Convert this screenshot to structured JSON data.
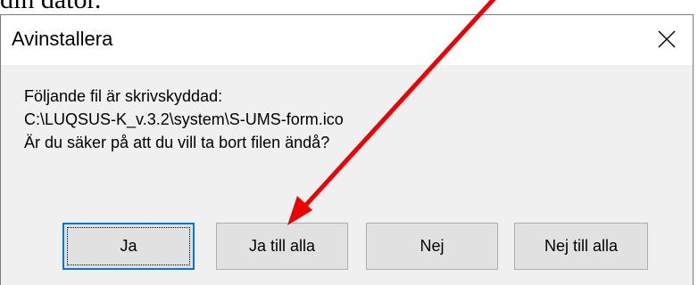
{
  "page": {
    "above_text": "din dator."
  },
  "dialog": {
    "title": "Avinstallera",
    "close_glyph": "✕",
    "message_lines": [
      "Följande fil är skrivskyddad:",
      "C:\\LUQSUS-K_v.3.2\\system\\S-UMS-form.ico",
      "Är du säker på att du vill ta bort filen ändå?"
    ],
    "buttons": {
      "yes": "Ja",
      "yes_all": "Ja till alla",
      "no": "Nej",
      "no_all": "Nej till alla"
    }
  },
  "annotation": {
    "arrow_color": "#ee0000",
    "icon": "red-arrow-icon"
  },
  "colors": {
    "dialog_bg": "#f0f0f0",
    "button_bg": "#e1e1e1",
    "focus_border": "#0078d7"
  }
}
